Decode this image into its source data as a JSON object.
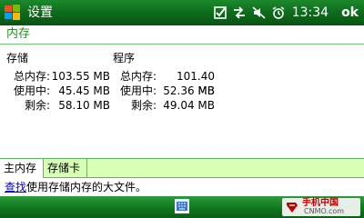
{
  "titlebar": {
    "title": "设置",
    "time": "13:34",
    "ok_label": "ok",
    "icons": [
      "windows-start-icon",
      "checkbox-icon",
      "connectivity-icon",
      "sound-off-icon",
      "alarm-icon"
    ]
  },
  "header": {
    "title": "内存"
  },
  "storage": {
    "heading": "存储",
    "rows": [
      {
        "label": "总内存:",
        "value": "103.55 MB"
      },
      {
        "label": "使用中:",
        "value": "45.45 MB"
      },
      {
        "label": "剩余:",
        "value": "58.10 MB"
      }
    ]
  },
  "program": {
    "heading": "程序",
    "rows": [
      {
        "label": "总内存:",
        "value": "101.40 MB"
      },
      {
        "label": "使用中:",
        "value": "52.36 MB"
      },
      {
        "label": "剩余:",
        "value": "49.04 MB"
      }
    ]
  },
  "tabs": [
    {
      "label": "主内存"
    },
    {
      "label": "存储卡"
    }
  ],
  "find": {
    "link": "查找",
    "text": "使用存储内存的大文件。"
  },
  "watermark": {
    "cn": "手机中国",
    "en": "CNMO.com"
  },
  "colors": {
    "titlebar": "#0f6d1d",
    "accent_green": "#2b8a2b",
    "tab_inactive_bg": "#d7ffb5",
    "link": "#0000cc"
  }
}
